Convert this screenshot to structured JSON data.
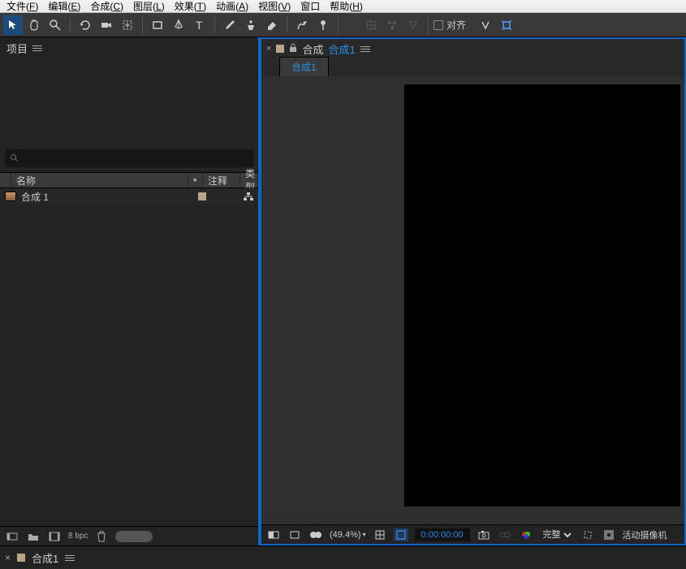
{
  "menu": {
    "items": [
      {
        "label": "文件",
        "key": "F"
      },
      {
        "label": "编辑",
        "key": "E"
      },
      {
        "label": "合成",
        "key": "C"
      },
      {
        "label": "图层",
        "key": "L"
      },
      {
        "label": "效果",
        "key": "T"
      },
      {
        "label": "动画",
        "key": "A"
      },
      {
        "label": "视图",
        "key": "V"
      },
      {
        "label": "窗口",
        "key": ""
      },
      {
        "label": "帮助",
        "key": "H"
      }
    ]
  },
  "toolbar": {
    "align_label": "对齐"
  },
  "project": {
    "title": "项目",
    "columns": {
      "name": "名称",
      "tag": "",
      "comment": "注释",
      "type": "类型"
    },
    "items": [
      {
        "name": "合成  1"
      }
    ],
    "footer": {
      "bpc": "8 bpc"
    }
  },
  "viewer": {
    "breadcrumb_prefix": "合成",
    "breadcrumb_link": "合成1",
    "active_tab": "合成1",
    "footer": {
      "zoom": "(49.4%)",
      "time": "0:00:00:00",
      "resolution": "完整",
      "camera": "活动摄像机"
    }
  },
  "timeline": {
    "name": "合成1"
  }
}
